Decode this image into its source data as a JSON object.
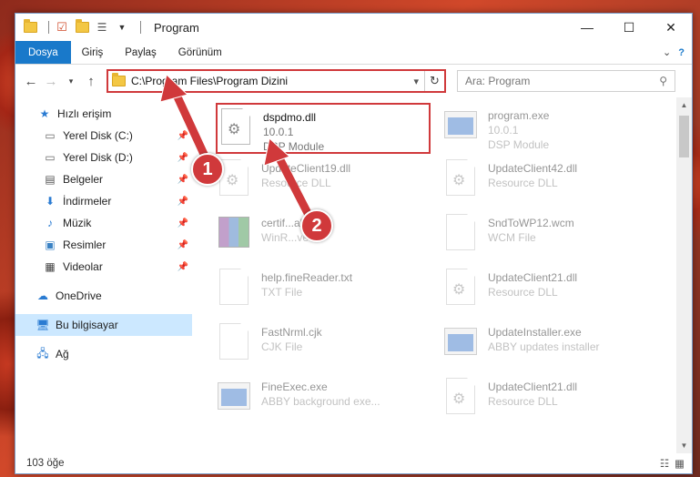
{
  "window": {
    "title": "Program"
  },
  "controls": {
    "minimize": "—",
    "maximize": "☐",
    "close": "✕"
  },
  "ribbon": {
    "tabs": [
      {
        "label": "Dosya",
        "active": true
      },
      {
        "label": "Giriş"
      },
      {
        "label": "Paylaş"
      },
      {
        "label": "Görünüm"
      }
    ],
    "expand": "⌄",
    "help": "?"
  },
  "address": {
    "path": "C:\\Program Files\\Program Dizini"
  },
  "search": {
    "placeholder": "Ara: Program"
  },
  "nav": {
    "quick_access": "Hızlı erişim",
    "items": [
      {
        "label": "Yerel Disk (C:)",
        "icon": "drive-icon"
      },
      {
        "label": "Yerel Disk (D:)",
        "icon": "drive-icon"
      },
      {
        "label": "Belgeler",
        "icon": "documents-icon"
      },
      {
        "label": "İndirmeler",
        "icon": "download-icon"
      },
      {
        "label": "Müzik",
        "icon": "music-icon"
      },
      {
        "label": "Resimler",
        "icon": "pictures-icon"
      },
      {
        "label": "Videolar",
        "icon": "videos-icon"
      }
    ],
    "onedrive": "OneDrive",
    "this_pc": "Bu bilgisayar",
    "network": "Ağ"
  },
  "files": [
    {
      "name": "dspdmo.dll",
      "line2": "10.0.1",
      "line3": "DSP Module",
      "type": "dll"
    },
    {
      "name": "program.exe",
      "line2": "10.0.1",
      "line3": "DSP Module",
      "type": "exe"
    },
    {
      "name": "UpdateClient19.dll",
      "line2": "Resource DLL",
      "type": "dll"
    },
    {
      "name": "UpdateClient42.dll",
      "line2": "Resource DLL",
      "type": "dll"
    },
    {
      "name": "certif...ab",
      "line2": "WinR...ve",
      "type": "rar"
    },
    {
      "name": "SndToWP12.wcm",
      "line2": "WCM File",
      "type": "doc"
    },
    {
      "name": "help.fineReader.txt",
      "line2": "TXT File",
      "type": "doc"
    },
    {
      "name": "UpdateClient21.dll",
      "line2": "Resource DLL",
      "type": "dll"
    },
    {
      "name": "FastNrml.cjk",
      "line2": "CJK File",
      "type": "doc"
    },
    {
      "name": "UpdateInstaller.exe",
      "line2": "ABBY updates installer",
      "type": "exe"
    },
    {
      "name": "FineExec.exe",
      "line2": "ABBY background exe...",
      "type": "exe"
    },
    {
      "name": "UpdateClient21.dll",
      "line2": "Resource DLL",
      "type": "dll"
    }
  ],
  "status": {
    "count": "103 öğe"
  },
  "annotations": {
    "step1": "1",
    "step2": "2",
    "color": "#d0393b"
  }
}
